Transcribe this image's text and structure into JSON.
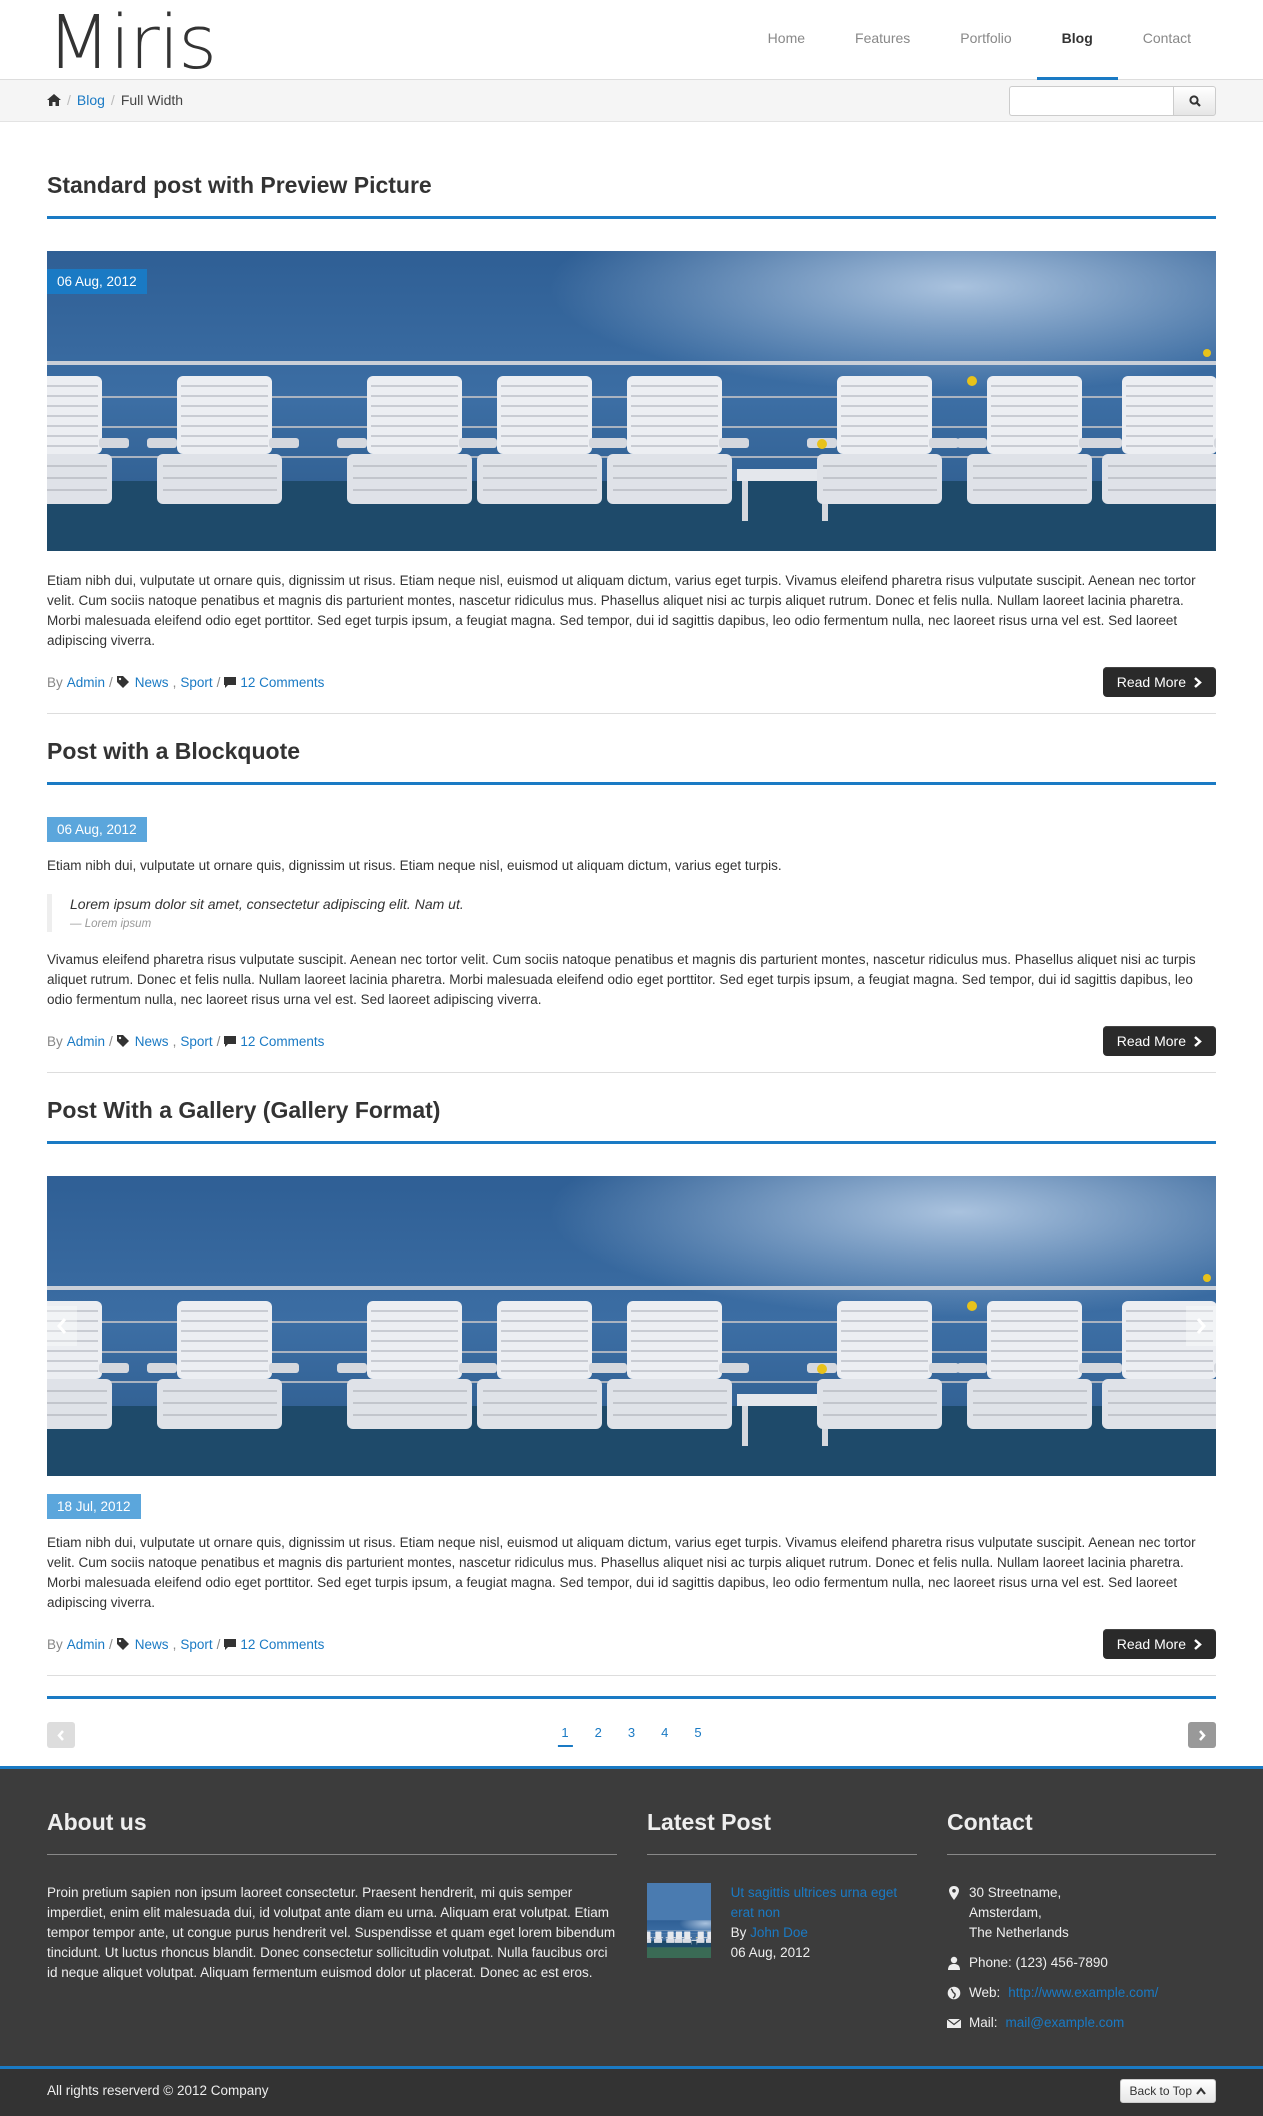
{
  "header": {
    "logo": "Miris",
    "nav": [
      "Home",
      "Features",
      "Portfolio",
      "Blog",
      "Contact"
    ],
    "active_nav": "Blog"
  },
  "breadcrumb": {
    "items": [
      "Blog",
      "Full Width"
    ],
    "separator": "/"
  },
  "search": {
    "placeholder": ""
  },
  "posts": [
    {
      "title": "Standard post with Preview Picture",
      "date": "06 Aug, 2012",
      "text": "Etiam nibh dui, vulputate ut ornare quis, dignissim ut risus. Etiam neque nisl, euismod ut aliquam dictum, varius eget turpis. Vivamus eleifend pharetra risus vulputate suscipit. Aenean nec tortor velit. Cum sociis natoque penatibus et magnis dis parturient montes, nascetur ridiculus mus. Phasellus aliquet nisi ac turpis aliquet rutrum. Donec et felis nulla. Nullam laoreet lacinia pharetra. Morbi malesuada eleifend odio eget porttitor. Sed eget turpis ipsum, a feugiat magna. Sed tempor, dui id sagittis dapibus, leo odio fermentum nulla, nec laoreet risus urna vel est. Sed laoreet adipiscing viverra.",
      "meta": {
        "by": "By",
        "author": "Admin",
        "sep": "/",
        "cat1": "News",
        "cat2": "Sport",
        "comments": "12 Comments"
      },
      "read_more": "Read More"
    },
    {
      "title": "Post with a Blockquote",
      "date": "06 Aug, 2012",
      "intro": "Etiam nibh dui, vulputate ut ornare quis, dignissim ut risus. Etiam neque nisl, euismod ut aliquam dictum, varius eget turpis.",
      "quote": "Lorem ipsum dolor sit amet, consectetur adipiscing elit. Nam ut.",
      "quote_source": "— Lorem ipsum",
      "text": "Vivamus eleifend pharetra risus vulputate suscipit. Aenean nec tortor velit. Cum sociis natoque penatibus et magnis dis parturient montes, nascetur ridiculus mus. Phasellus aliquet nisi ac turpis aliquet rutrum. Donec et felis nulla. Nullam laoreet lacinia pharetra. Morbi malesuada eleifend odio eget porttitor. Sed eget turpis ipsum, a feugiat magna. Sed tempor, dui id sagittis dapibus, leo odio fermentum nulla, nec laoreet risus urna vel est. Sed laoreet adipiscing viverra.",
      "meta": {
        "by": "By",
        "author": "Admin",
        "sep": "/",
        "cat1": "News",
        "cat2": "Sport",
        "comments": "12 Comments"
      },
      "read_more": "Read More"
    },
    {
      "title": "Post With a Gallery (Gallery Format)",
      "date": "18 Jul, 2012",
      "text": "Etiam nibh dui, vulputate ut ornare quis, dignissim ut risus. Etiam neque nisl, euismod ut aliquam dictum, varius eget turpis. Vivamus eleifend pharetra risus vulputate suscipit. Aenean nec tortor velit. Cum sociis natoque penatibus et magnis dis parturient montes, nascetur ridiculus mus. Phasellus aliquet nisi ac turpis aliquet rutrum. Donec et felis nulla. Nullam laoreet lacinia pharetra. Morbi malesuada eleifend odio eget porttitor. Sed eget turpis ipsum, a feugiat magna. Sed tempor, dui id sagittis dapibus, leo odio fermentum nulla, nec laoreet risus urna vel est. Sed laoreet adipiscing viverra.",
      "meta": {
        "by": "By",
        "author": "Admin",
        "sep": "/",
        "cat1": "News",
        "cat2": "Sport",
        "comments": "12 Comments"
      },
      "read_more": "Read More"
    }
  ],
  "pagination": {
    "pages": [
      "1",
      "2",
      "3",
      "4",
      "5"
    ],
    "active": "1"
  },
  "footer": {
    "about": {
      "title": "About us",
      "text": "Proin pretium sapien non ipsum laoreet consectetur. Praesent hendrerit, mi quis semper imperdiet, enim elit malesuada dui, id volutpat ante diam eu urna. Aliquam erat volutpat. Etiam tempor tempor ante, ut congue purus hendrerit vel. Suspendisse et quam eget lorem bibendum tincidunt. Ut luctus rhoncus blandit. Donec consectetur sollicitudin volutpat. Nulla faucibus orci id neque aliquet volutpat. Aliquam fermentum euismod dolor ut placerat. Donec ac est eros."
    },
    "latest": {
      "title": "Latest Post",
      "post_title": "Ut sagittis ultrices urna eget erat non",
      "by": "By",
      "author": "John Doe",
      "date": "06 Aug, 2012"
    },
    "contact": {
      "title": "Contact",
      "address": [
        "30 Streetname,",
        "Amsterdam,",
        "The Netherlands"
      ],
      "phone": "Phone: (123) 456-7890",
      "web_label": "Web:",
      "web": "http://www.example.com/",
      "mail_label": "Mail:",
      "mail": "mail@example.com"
    }
  },
  "bottom": {
    "copyright": "All rights reserverd © 2012 Company",
    "back_to_top": "Back to Top"
  },
  "colors": {
    "accent": "#1a7ac4",
    "footer_bg": "#3c3c3c",
    "dark_button": "#2a2a2a"
  },
  "icons": [
    "home-icon",
    "search-icon",
    "tags-icon",
    "comment-icon",
    "chevron-right-icon",
    "chevron-left-icon",
    "map-marker-icon",
    "user-icon",
    "globe-icon",
    "envelope-icon",
    "chevron-up-icon"
  ]
}
